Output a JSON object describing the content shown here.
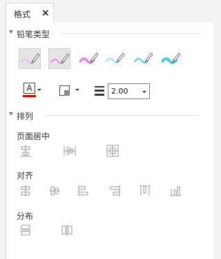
{
  "tab": {
    "label": "格式",
    "close": "×"
  },
  "sections": {
    "pencil_type": "铅笔类型",
    "arrange": "排列"
  },
  "pencils": [
    {
      "name": "pencil-thin-pink",
      "color": "#e08fe8",
      "width": 1,
      "selected": true
    },
    {
      "name": "pencil-medium-pink",
      "color": "#e08fe8",
      "width": 2,
      "selected": true
    },
    {
      "name": "pencil-thick-pink",
      "color": "#e08fe8",
      "width": 4,
      "selected": false
    },
    {
      "name": "pencil-thin-cyan",
      "color": "#3ad0f0",
      "width": 1,
      "selected": false
    },
    {
      "name": "pencil-medium-cyan",
      "color": "#3ad0f0",
      "width": 2,
      "selected": false
    },
    {
      "name": "pencil-thick-cyan",
      "color": "#3ad0f0",
      "width": 4,
      "selected": false
    }
  ],
  "format_tools": {
    "text_color_glyph": "A",
    "text_color": "#d40000",
    "line_width": "2.00"
  },
  "groups": {
    "center": "页面居中",
    "align": "对齐",
    "distribute": "分布"
  },
  "icons": {
    "center": [
      "center-horizontal-icon",
      "center-vertical-icon",
      "center-both-icon"
    ],
    "align": [
      "align-left-icon",
      "align-center-icon",
      "align-right-icon",
      "align-top-icon",
      "align-middle-icon",
      "align-bottom-icon"
    ],
    "distribute": [
      "distribute-horizontal-icon",
      "distribute-vertical-icon"
    ]
  }
}
